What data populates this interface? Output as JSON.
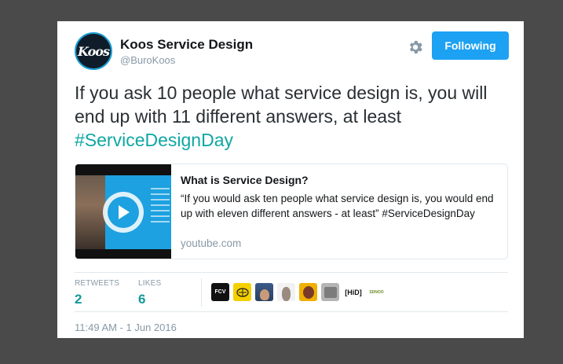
{
  "account": {
    "avatar_text": "Koos",
    "name": "Koos Service Design",
    "handle": "@BuroKoos",
    "follow_label": "Following"
  },
  "tweet": {
    "text": "If you ask 10 people what service design is, you will end up with 11 different answers, at least",
    "hashtag": "#ServiceDesignDay"
  },
  "link_card": {
    "title": "What is Service Design?",
    "description": "“If you would ask ten people what service design is, you would end up with eleven different answers - at least” #ServiceDesignDay",
    "domain": "youtube.com"
  },
  "stats": {
    "retweets_label": "RETWEETS",
    "retweets_value": "2",
    "likes_label": "LIKES",
    "likes_value": "6"
  },
  "likers": [
    {
      "text": "FCV"
    },
    {
      "text": ""
    },
    {
      "text": ""
    },
    {
      "text": ""
    },
    {
      "text": ""
    },
    {
      "text": ""
    },
    {
      "text": "[HiD]"
    },
    {
      "text": "SDNOO"
    }
  ],
  "timestamp": "11:49 AM - 1 Jun 2016",
  "colors": {
    "follow_button": "#1da1f2",
    "hashtag": "#0fa7a2",
    "stat_value": "#14979a"
  }
}
